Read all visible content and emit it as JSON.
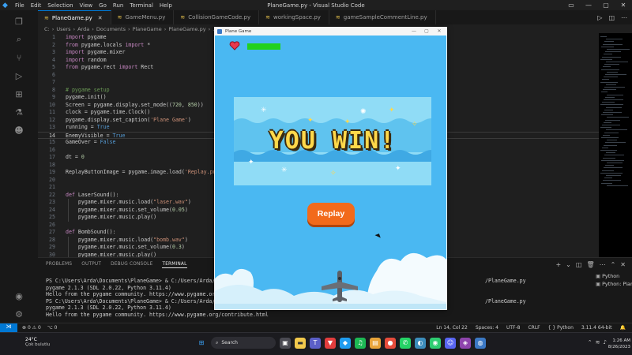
{
  "window": {
    "title": "PlaneGame.py - Visual Studio Code",
    "menu": [
      "File",
      "Edit",
      "Selection",
      "View",
      "Go",
      "Run",
      "Terminal",
      "Help"
    ]
  },
  "tabs": [
    {
      "label": "PlaneGame.py",
      "active": true
    },
    {
      "label": "GameMenu.py"
    },
    {
      "label": "CollisionGameCode.py"
    },
    {
      "label": "workingSpace.py"
    },
    {
      "label": "gameSampleCommentLine.py"
    }
  ],
  "breadcrumb": [
    "C:",
    "Users",
    "Arda",
    "Documents",
    "PlaneGame",
    "PlaneGame.py",
    "..."
  ],
  "code_lines": [
    {
      "n": "1",
      "t": "import pygame"
    },
    {
      "n": "2",
      "t": "from pygame.locals import *"
    },
    {
      "n": "3",
      "t": "import pygame.mixer"
    },
    {
      "n": "4",
      "t": "import random"
    },
    {
      "n": "5",
      "t": "from pygame.rect import Rect"
    },
    {
      "n": "6",
      "t": ""
    },
    {
      "n": "7",
      "t": ""
    },
    {
      "n": "8",
      "t": "# pygame setup"
    },
    {
      "n": "9",
      "t": "pygame.init()"
    },
    {
      "n": "10",
      "t": "Screen = pygame.display.set_mode((720, 850))"
    },
    {
      "n": "11",
      "t": "clock = pygame.time.Clock()"
    },
    {
      "n": "12",
      "t": "pygame.display.set_caption('Plane Game')"
    },
    {
      "n": "13",
      "t": "running = True"
    },
    {
      "n": "14",
      "t": "EnemyVisible = True"
    },
    {
      "n": "15",
      "t": "GameOver = False"
    },
    {
      "n": "16",
      "t": ""
    },
    {
      "n": "17",
      "t": "dt = 0"
    },
    {
      "n": "18",
      "t": ""
    },
    {
      "n": "19",
      "t": "ReplayButtonImage = pygame.image.load('Replay.png')"
    },
    {
      "n": "20",
      "t": ""
    },
    {
      "n": "21",
      "t": ""
    },
    {
      "n": "22",
      "t": "def LaserSound():"
    },
    {
      "n": "23",
      "t": "    pygame.mixer.music.load(\"laser.wav\")"
    },
    {
      "n": "24",
      "t": "    pygame.mixer.music.set_volume(0.05)"
    },
    {
      "n": "25",
      "t": "    pygame.mixer.music.play()"
    },
    {
      "n": "26",
      "t": ""
    },
    {
      "n": "27",
      "t": "def BombSound():"
    },
    {
      "n": "28",
      "t": "    pygame.mixer.music.load(\"bomb.wav\")"
    },
    {
      "n": "29",
      "t": "    pygame.mixer.music.set_volume(0.3)"
    },
    {
      "n": "30",
      "t": "    pygame.mixer.music.play()"
    },
    {
      "n": "31",
      "t": ""
    }
  ],
  "panel": {
    "tabs": [
      "PROBLEMS",
      "OUTPUT",
      "DEBUG CONSOLE",
      "TERMINAL"
    ],
    "active_tab": "TERMINAL",
    "terminal_lines": [
      "PS C:\\Users\\Arda\\Documents\\PlaneGame> & C:/Users/Arda/App",
      "pygame 2.1.3 (SDL 2.0.22, Python 3.11.4)",
      "Hello from the pygame community. https://www.pygame.org/c",
      "PS C:\\Users\\Arda\\Documents\\PlaneGame> & C:/Users/Arda/App",
      "pygame 2.1.3 (SDL 2.0.22, Python 3.11.4)",
      "Hello from the pygame community. https://www.pygame.org/contribute.html"
    ],
    "terminal_tail_1": "/PlaneGame.py",
    "terminal_tail_2": "/PlaneGame.py",
    "terminal_list": [
      "Python",
      "Python: Plan"
    ]
  },
  "statusbar": {
    "errors": "0",
    "warnings": "0",
    "ports": "0",
    "position": "Ln 14, Col 22",
    "spaces": "Spaces: 4",
    "encoding": "UTF-8",
    "eol": "CRLF",
    "language": "Python",
    "interpreter": "3.11.4 64-bit"
  },
  "game": {
    "window_title": "Plane Game",
    "banner_text": "YOU WIN!",
    "replay_label": "Replay",
    "health_level": 1.0,
    "colors": {
      "sky": "#4ab8f2",
      "banner": "#8fd9f5",
      "text": "#ffd84a",
      "button": "#f26a1b",
      "health": "#22d11e"
    }
  },
  "taskbar": {
    "temperature": "24°C",
    "condition": "Çok bulutlu",
    "search_placeholder": "Search",
    "time": "1:26 AM",
    "date": "8/26/2023"
  }
}
